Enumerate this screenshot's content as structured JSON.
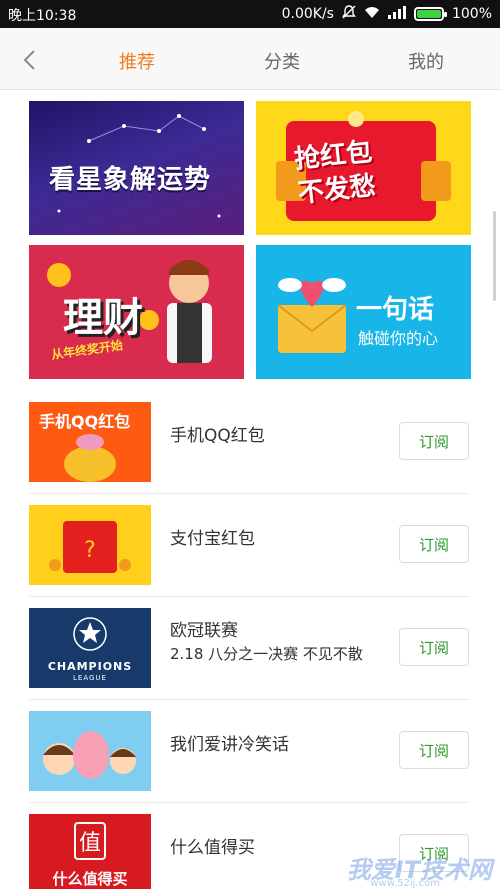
{
  "status_bar": {
    "time": "晚上10:38",
    "speed": "0.00K/s",
    "battery": "100%",
    "battery_level": 1.0,
    "icons": [
      "mute-icon",
      "wifi-icon",
      "signal-icon",
      "battery-icon"
    ]
  },
  "nav": {
    "back_icon": "back-chevron-icon",
    "tabs": [
      {
        "label": "推荐",
        "active": true
      },
      {
        "label": "分类",
        "active": false
      },
      {
        "label": "我的",
        "active": false
      }
    ],
    "active_color": "#f07b1e"
  },
  "banners": [
    {
      "title": "看星象解运势"
    },
    {
      "title_line1": "抢红包",
      "title_line2": "不发愁"
    },
    {
      "title": "理财",
      "subtitle": "从年终奖开始"
    },
    {
      "title": "一句话",
      "subtitle": "触碰你的心"
    }
  ],
  "list": [
    {
      "name": "手机QQ红包",
      "desc": "",
      "button": "订阅",
      "thumb_text": "手机QQ红包"
    },
    {
      "name": "支付宝红包",
      "desc": "",
      "button": "订阅"
    },
    {
      "name": "欧冠联赛",
      "desc": "2.18 八分之一决赛 不见不散",
      "button": "订阅",
      "thumb_text": "CHAMPIONS",
      "thumb_text2": "LEAGUE"
    },
    {
      "name": "我们爱讲冷笑话",
      "desc": "",
      "button": "订阅"
    },
    {
      "name": "什么值得买",
      "desc": "",
      "button": "订阅",
      "thumb_text": "什么值得买",
      "thumb_seal": "值"
    }
  ],
  "watermark": {
    "text": "我爱IT技术网",
    "sub": "www.52ij.com"
  },
  "colors": {
    "subscribe_text": "#2e9a2e"
  }
}
